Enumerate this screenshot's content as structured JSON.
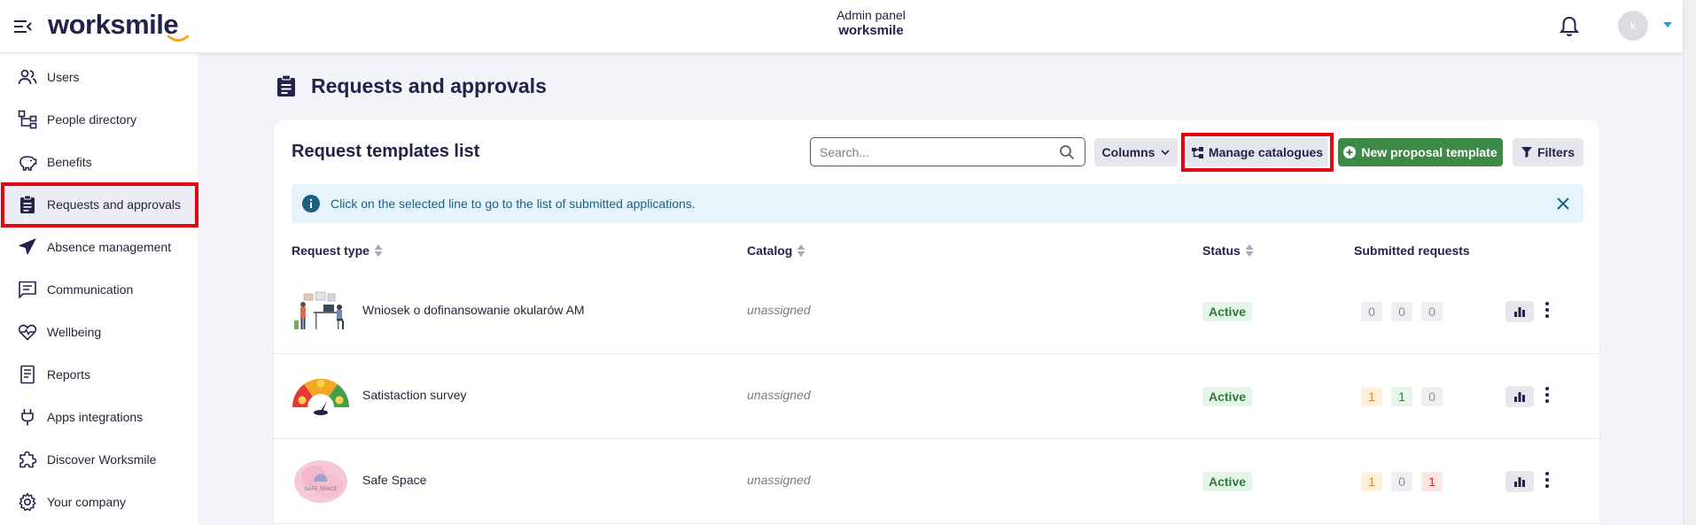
{
  "header": {
    "logo_text": "worksmile",
    "admin_label": "Admin panel",
    "admin_brand": "worksmile",
    "avatar_initial": "k",
    "accent_color": "#1ba0e0"
  },
  "sidebar": {
    "items": [
      {
        "label": "Users",
        "icon": "users-icon"
      },
      {
        "label": "People directory",
        "icon": "org-chart-icon"
      },
      {
        "label": "Benefits",
        "icon": "piggy-bank-icon"
      },
      {
        "label": "Requests and approvals",
        "icon": "clipboard-icon",
        "active": true
      },
      {
        "label": "Absence management",
        "icon": "airplane-icon"
      },
      {
        "label": "Communication",
        "icon": "message-icon"
      },
      {
        "label": "Wellbeing",
        "icon": "heart-pulse-icon"
      },
      {
        "label": "Reports",
        "icon": "report-icon"
      },
      {
        "label": "Apps integrations",
        "icon": "plug-icon"
      },
      {
        "label": "Discover Worksmile",
        "icon": "puzzle-icon"
      },
      {
        "label": "Your company",
        "icon": "gear-icon"
      }
    ]
  },
  "page": {
    "title": "Requests and approvals"
  },
  "card": {
    "title": "Request templates list",
    "search_placeholder": "Search...",
    "columns_label": "Columns",
    "manage_catalogues_label": "Manage catalogues",
    "new_template_label": "New proposal template",
    "filters_label": "Filters",
    "info_text": "Click on the selected line to go to the list of submitted applications.",
    "columns": {
      "request_type": "Request type",
      "catalog": "Catalog",
      "status": "Status",
      "submitted": "Submitted requests"
    },
    "rows": [
      {
        "name": "Wniosek o dofinansowanie okularów AM",
        "catalog": "unassigned",
        "status": "Active",
        "counts": [
          "0",
          "0",
          "0"
        ],
        "thumb_icon": "office-illustration-icon"
      },
      {
        "name": "Satistaction survey",
        "catalog": "unassigned",
        "status": "Active",
        "counts": [
          "1",
          "1",
          "0"
        ],
        "thumb_icon": "satisfaction-gauge-icon"
      },
      {
        "name": "Safe Space",
        "catalog": "unassigned",
        "status": "Active",
        "counts": [
          "1",
          "0",
          "1"
        ],
        "thumb_icon": "safe-space-logo-icon",
        "thumb_text": "SAFE SPACE"
      }
    ]
  },
  "colors": {
    "primary_green": "#3c8a46",
    "highlight_red": "#e3000f",
    "info_bg": "#e6f5fb",
    "navy": "#22234b"
  }
}
